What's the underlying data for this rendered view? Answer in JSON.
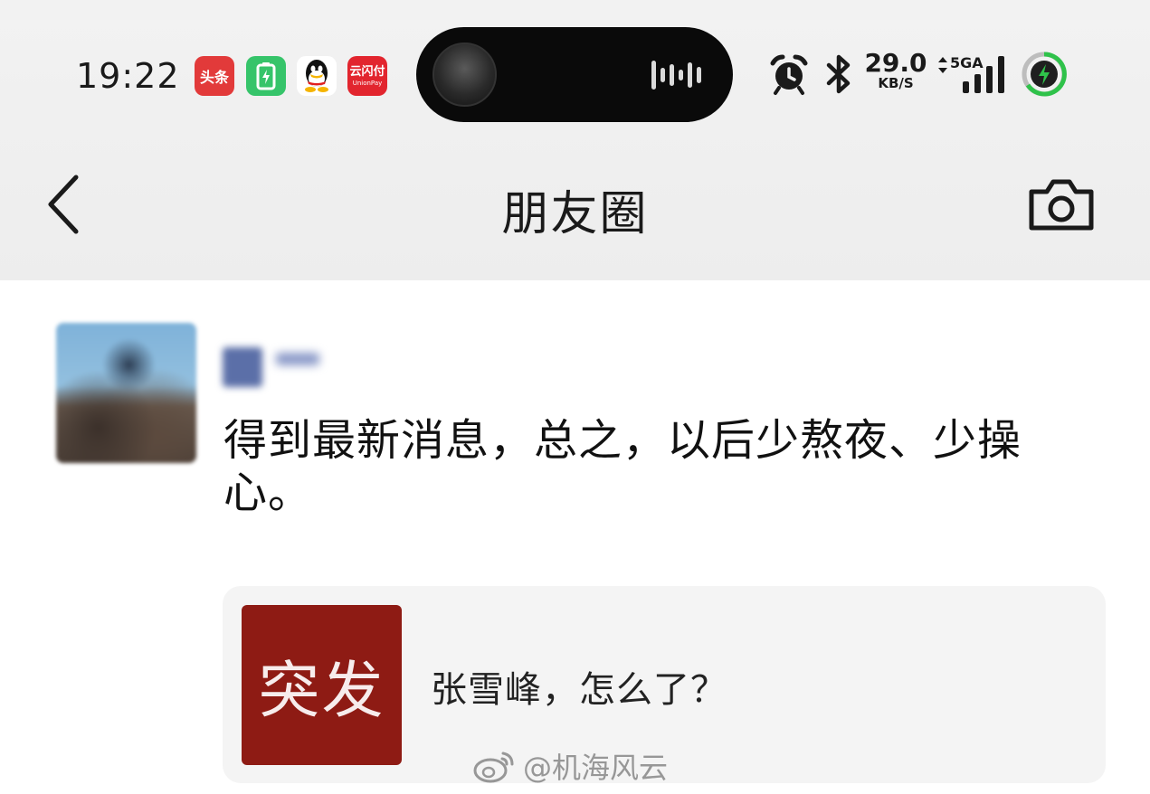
{
  "status_bar": {
    "time": "19:22",
    "apps": [
      {
        "name": "toutiao",
        "label": "头条"
      },
      {
        "name": "battery-app",
        "label": ""
      },
      {
        "name": "qq",
        "label": ""
      },
      {
        "name": "unionpay",
        "label": "云闪付",
        "sub": "UnionPay"
      }
    ],
    "net_speed_value": "29.0",
    "net_speed_unit": "KB/S",
    "network_type": "5GA"
  },
  "nav": {
    "title": "朋友圈"
  },
  "post": {
    "text": "得到最新消息，总之，以后少熬夜、少操心。",
    "share": {
      "thumb_text": "突发",
      "title": "张雪峰，怎么了？"
    }
  },
  "watermark": {
    "text": "@机海风云"
  },
  "colors": {
    "nav_background": "#ededed",
    "thumb_background": "#8e1b14",
    "battery_green": "#2fc24a"
  }
}
